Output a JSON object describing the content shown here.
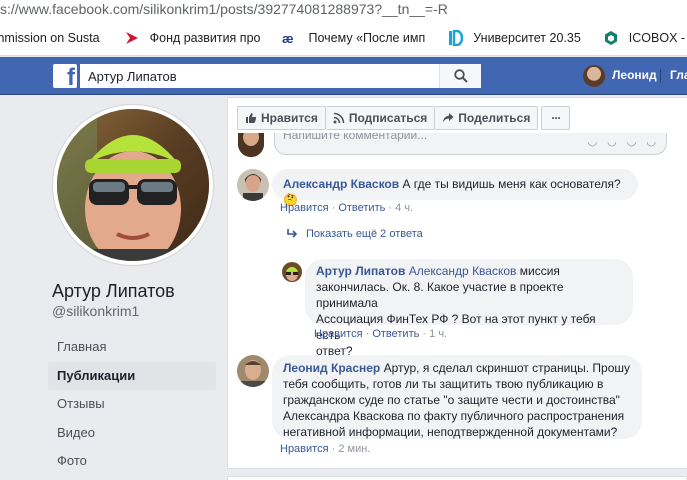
{
  "browser": {
    "url": "s://www.facebook.com/silikonkrim1/posts/392774081288973?__tn__=-R"
  },
  "bookmarks": [
    {
      "label": "mmission on Susta",
      "icon": "none"
    },
    {
      "label": "Фонд развития про",
      "icon": "red-arrow-icon"
    },
    {
      "label": "Почему «После имп",
      "icon": "ae-icon"
    },
    {
      "label": "Университет 20.35",
      "icon": "id-icon"
    },
    {
      "label": "ICOBOX - Launch y",
      "icon": "icobox-icon"
    }
  ],
  "header": {
    "search_value": "Артур Липатов",
    "user_name": "Леонид",
    "home_label": "Гла",
    "brand_color": "#4267b2"
  },
  "profile": {
    "name": "Артур Липатов",
    "handle": "@silikonkrim1",
    "menu": [
      {
        "label": "Главная"
      },
      {
        "label": "Публикации"
      },
      {
        "label": "Отзывы"
      },
      {
        "label": "Видео"
      },
      {
        "label": "Фото"
      }
    ]
  },
  "actions": {
    "like": "Нравится",
    "follow": "Подписаться",
    "share": "Поделиться",
    "more": "···"
  },
  "comment_input": {
    "placeholder": "Напишите комментарий..."
  },
  "comments": [
    {
      "author": "Александр Квасков",
      "text": "А где ты видишь меня как основателя? 🤔",
      "like_label": "Нравится",
      "reply_label": "Ответить",
      "time": "4 ч."
    },
    {
      "more_replies": "Показать ещё 2 ответа"
    },
    {
      "author": "Артур Липатов",
      "mention": "Александр Квасков",
      "text_line1": " миссия",
      "text_line2": "закончилась. Ок. 8. Какое участие в проекте принимала",
      "text_line3": "Ассоциация ФинТех РФ ? Вот на этот пункт у тебя есть",
      "text_line4": "ответ?",
      "like_label": "Нравится",
      "reply_label": "Ответить",
      "time": "1 ч."
    },
    {
      "author": "Леонид Краснер",
      "text_line1": " Артур, я сделал скриншот страницы. Прошу",
      "text_line2": "тебя сообщить, готов ли ты защитить твою публикацию в",
      "text_line3": "гражданском суде по статье \"о защите чести и достоинства\"",
      "text_line4": "Александра Кваскова по факту публичного распространения",
      "text_line5": "негативной информации, неподтвержденной документами?",
      "like_label": "Нравится",
      "time": "2 мин."
    }
  ]
}
